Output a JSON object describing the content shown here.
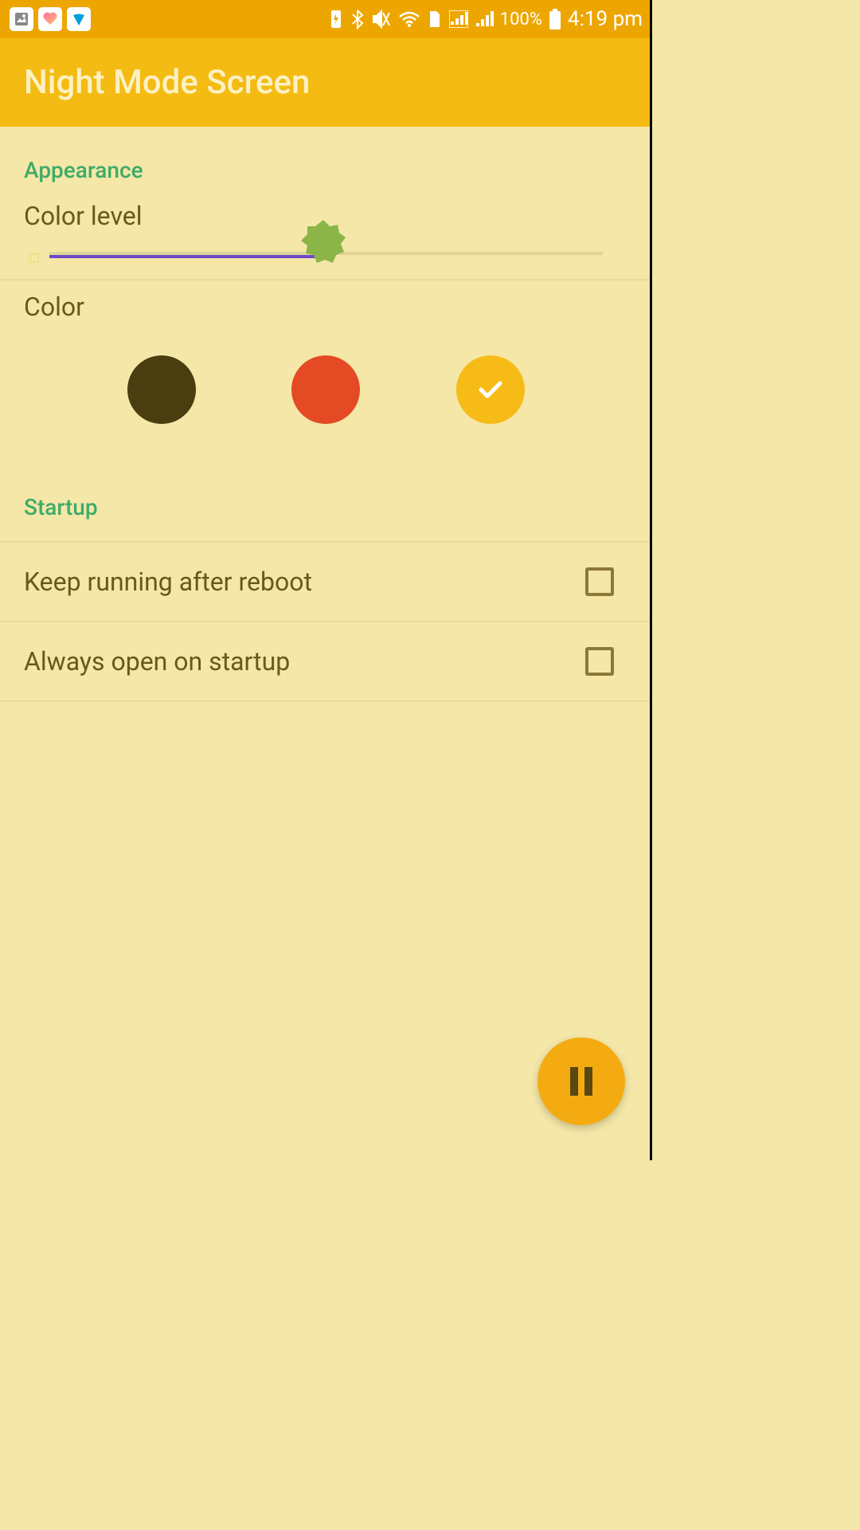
{
  "status_bar": {
    "battery_percent": "100%",
    "time": "4:19 pm"
  },
  "app_bar": {
    "title": "Night Mode Screen"
  },
  "sections": {
    "appearance": {
      "header": "Appearance",
      "color_level": {
        "label": "Color level",
        "value_percent": 46
      },
      "color": {
        "label": "Color",
        "options": [
          {
            "color": "#4a3e11",
            "selected": false
          },
          {
            "color": "#e44a23",
            "selected": false
          },
          {
            "color": "#f7bb18",
            "selected": true
          }
        ]
      }
    },
    "startup": {
      "header": "Startup",
      "items": [
        {
          "label": "Keep running after reboot",
          "checked": false
        },
        {
          "label": "Always open on startup",
          "checked": false
        }
      ]
    }
  },
  "colors": {
    "slider_thumb": "#8cb548",
    "check_icon": "#ffffff"
  }
}
